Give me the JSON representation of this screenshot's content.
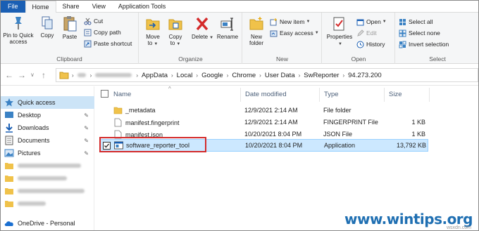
{
  "ribbon_tabs": [
    "File",
    "Home",
    "Share",
    "View",
    "Application Tools"
  ],
  "clipboard": {
    "pin_label_1": "Pin to Quick",
    "pin_label_2": "access",
    "copy": "Copy",
    "paste": "Paste",
    "cut": "Cut",
    "copy_path": "Copy path",
    "paste_shortcut": "Paste shortcut",
    "group": "Clipboard"
  },
  "organize": {
    "move_1": "Move",
    "move_2": "to",
    "copy_1": "Copy",
    "copy_2": "to",
    "delete": "Delete",
    "rename": "Rename",
    "group": "Organize"
  },
  "new": {
    "new_folder_1": "New",
    "new_folder_2": "folder",
    "new_item": "New item",
    "easy_access": "Easy access",
    "group": "New"
  },
  "open": {
    "properties": "Properties",
    "open": "Open",
    "edit": "Edit",
    "history": "History",
    "group": "Open"
  },
  "select": {
    "select_all": "Select all",
    "select_none": "Select none",
    "invert": "Invert selection",
    "group": "Select"
  },
  "breadcrumb": [
    "AppData",
    "Local",
    "Google",
    "Chrome",
    "User Data",
    "SwReporter",
    "94.273.200"
  ],
  "nav_pane": {
    "quick_access": "Quick access",
    "items": [
      "Desktop",
      "Downloads",
      "Documents",
      "Pictures"
    ],
    "onedrive": "OneDrive - Personal"
  },
  "columns": {
    "name": "Name",
    "date": "Date modified",
    "type": "Type",
    "size": "Size"
  },
  "files": [
    {
      "name": "_metadata",
      "date": "12/9/2021 2:14 AM",
      "type": "File folder",
      "size": ""
    },
    {
      "name": "manifest.fingerprint",
      "date": "12/9/2021 2:14 AM",
      "type": "FINGERPRINT File",
      "size": "1 KB"
    },
    {
      "name": "manifest.json",
      "date": "10/20/2021 8:04 PM",
      "type": "JSON File",
      "size": "1 KB"
    },
    {
      "name": "software_reporter_tool",
      "date": "10/20/2021 8:04 PM",
      "type": "Application",
      "size": "13,792 KB"
    }
  ],
  "watermark": "www.wintips.org",
  "watermark_sub": "wsxdn.com",
  "colors": {
    "file_tab": "#1a5fb4",
    "selection": "#cce8ff",
    "highlight_box": "#d42a2a",
    "folder": "#f0c24a"
  }
}
